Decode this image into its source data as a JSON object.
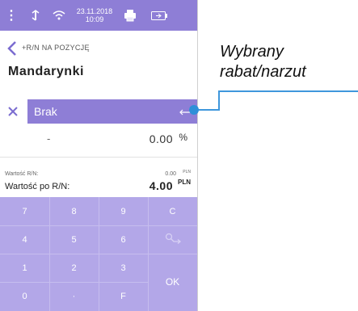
{
  "status_bar": {
    "date": "23.11.2018",
    "time": "10:09",
    "icons": [
      "menu-dots-icon",
      "signal-icon",
      "wifi-icon",
      "printer-icon",
      "battery-icon"
    ]
  },
  "header": {
    "breadcrumb": "+R/N NA POZYCJĘ",
    "title": "Mandarynki"
  },
  "discount": {
    "selected": "Brak",
    "clear_icon": "close-icon",
    "enter_icon": "enter-icon"
  },
  "amount": {
    "sign": "-",
    "value": "0.00",
    "unit": "%"
  },
  "summary": {
    "rn_label": "Wartość R/N:",
    "rn_value": "0.00",
    "rn_unit": "PLN",
    "after_label": "Wartość po R/N:",
    "after_value": "4.00",
    "after_unit": "PLN"
  },
  "keypad": {
    "rows": [
      [
        "7",
        "8",
        "9",
        "C"
      ],
      [
        "4",
        "5",
        "6",
        ""
      ],
      [
        "1",
        "2",
        "3"
      ],
      [
        "0",
        "·",
        "F"
      ]
    ],
    "ok": "OK",
    "backspace_icon": "backspace-icon"
  },
  "callout": {
    "line1": "Wybrany",
    "line2": "rabat/narzut"
  },
  "colors": {
    "status_bar": "#8e7ed6",
    "selected_field": "#8e7ed6",
    "keypad": "#b3a7e8",
    "accent_blue": "#2f8fd8"
  }
}
